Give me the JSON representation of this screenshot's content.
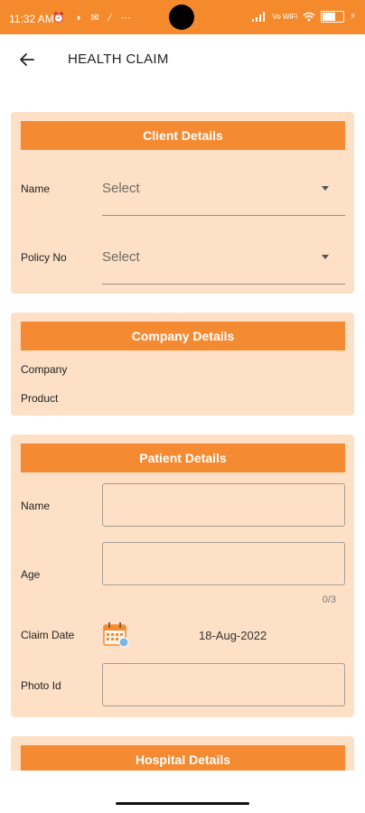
{
  "status_bar": {
    "time": "11:32 AM",
    "icons": "⏰ ◑ ✉ ⁄ ⋯",
    "network": "Vo WiFi"
  },
  "app_bar": {
    "title": "HEALTH CLAIM"
  },
  "client_details": {
    "header": "Client Details",
    "name_label": "Name",
    "name_value": "Select",
    "policy_label": "Policy No",
    "policy_value": "Select"
  },
  "company_details": {
    "header": "Company Details",
    "company_label": "Company",
    "product_label": "Product"
  },
  "patient_details": {
    "header": "Patient Details",
    "name_label": "Name",
    "age_label": "Age",
    "age_counter": "0/3",
    "claim_date_label": "Claim Date",
    "claim_date_value": "18-Aug-2022",
    "photo_id_label": "Photo Id"
  },
  "hospital_details": {
    "header": "Hospital Details"
  },
  "colors": {
    "accent": "#f48b33",
    "card_bg": "#fde0c5",
    "status_bar": "#f58a2d"
  },
  "icons": [
    "back-arrow-icon",
    "dropdown-caret-icon",
    "calendar-icon",
    "battery-icon",
    "wifi-icon",
    "signal-icon"
  ]
}
